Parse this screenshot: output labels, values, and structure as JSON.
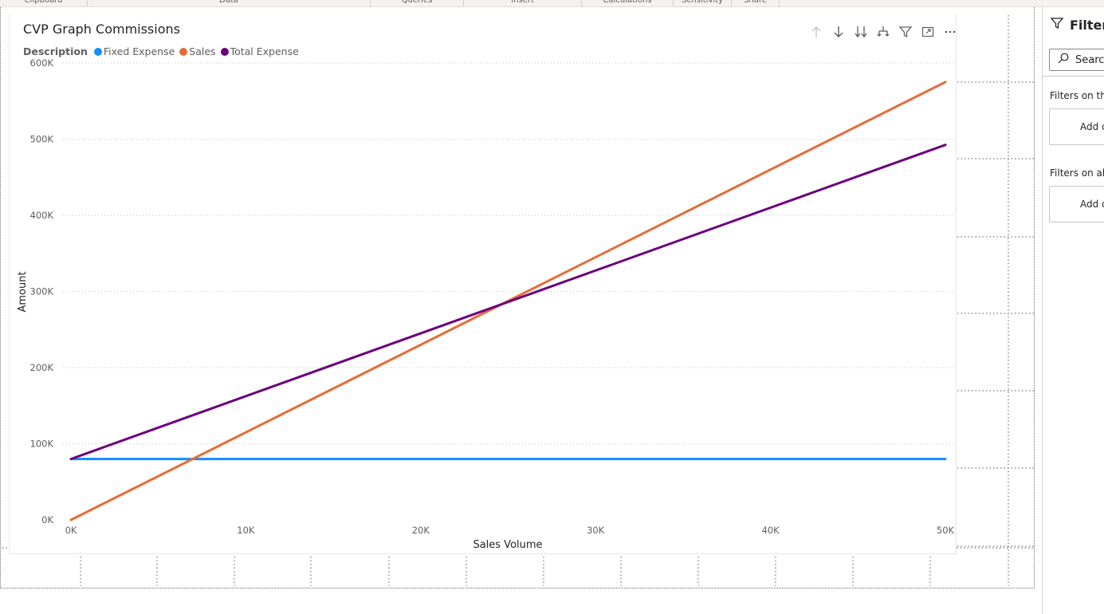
{
  "ribbon": {
    "groups": [
      "Clipboard",
      "Data",
      "Queries",
      "Insert",
      "Calculations",
      "Sensitivity",
      "Share"
    ]
  },
  "visual": {
    "title": "CVP Graph Commissions",
    "legend": {
      "title": "Description",
      "items": [
        {
          "label": "Fixed Expense",
          "color": "#118DFF"
        },
        {
          "label": "Sales",
          "color": "#E66C37"
        },
        {
          "label": "Total Expense",
          "color": "#6B007B"
        }
      ]
    },
    "toolbar": {
      "icons": [
        "arrow-up-icon",
        "arrow-down-icon",
        "double-arrow-down-icon",
        "expand-hierarchy-icon",
        "filter-icon",
        "focus-mode-icon",
        "more-options-icon"
      ]
    }
  },
  "chart_data": {
    "type": "line",
    "title": "CVP Graph Commissions",
    "xlabel": "Sales Volume",
    "ylabel": "Amount",
    "x_ticks": [
      "0K",
      "10K",
      "20K",
      "30K",
      "40K",
      "50K"
    ],
    "y_ticks": [
      "0K",
      "100K",
      "200K",
      "300K",
      "400K",
      "500K",
      "600K"
    ],
    "xlim": [
      0,
      50000
    ],
    "ylim": [
      0,
      600000
    ],
    "grid": true,
    "legend_position": "top-left",
    "x": [
      0,
      50000
    ],
    "series": [
      {
        "name": "Fixed Expense",
        "color": "#118DFF",
        "values": [
          80000,
          80000
        ]
      },
      {
        "name": "Sales",
        "color": "#E66C37",
        "values": [
          0,
          575000
        ]
      },
      {
        "name": "Total Expense",
        "color": "#6B007B",
        "values": [
          80000,
          492500
        ]
      }
    ]
  },
  "filters": {
    "title": "Filters",
    "search_placeholder": "Search",
    "section_page": "Filters on this page",
    "section_all": "Filters on all pages",
    "add_label": "Add data fields here"
  }
}
